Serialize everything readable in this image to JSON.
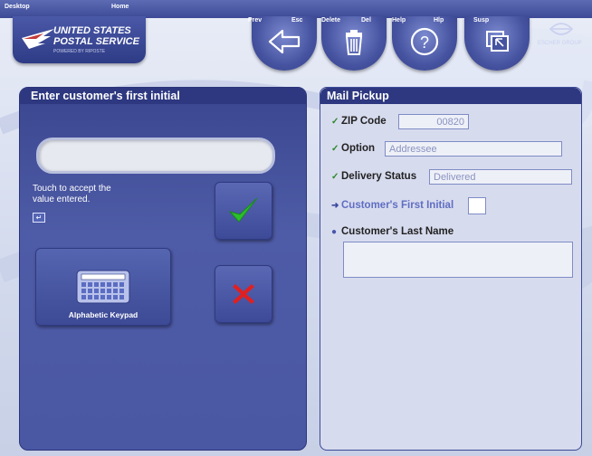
{
  "topbar": {
    "desktop": "Desktop",
    "home": "Home",
    "prev": "Prev",
    "esc": "Esc",
    "delete": "Delete",
    "del": "Del",
    "help": "Help",
    "hlp": "Hlp",
    "susp": "Susp"
  },
  "logo": {
    "line1": "UNITED STATES",
    "line2": "POSTAL SERVICE",
    "tagline": "POWERED BY RIPOSTE"
  },
  "brand_right": "ESCHER GROUP",
  "left_panel": {
    "title": "Enter customer's first initial",
    "entry_value": "",
    "hint_line1": "Touch to accept the",
    "hint_line2": "value entered.",
    "enter_glyph": "↵",
    "keypad_label": "Alphabetic Keypad"
  },
  "right_panel": {
    "title": "Mail Pickup",
    "fields": [
      {
        "label": "ZIP Code",
        "value": "00820",
        "status": "done"
      },
      {
        "label": "Option",
        "value": "Addressee",
        "status": "done"
      },
      {
        "label": "Delivery Status",
        "value": "Delivered",
        "status": "done"
      },
      {
        "label": "Customer's First Initial",
        "value": "",
        "status": "current"
      },
      {
        "label": "Customer's Last Name",
        "value": "",
        "status": "pending"
      }
    ]
  },
  "colors": {
    "accent": "#2d3880",
    "panel_left": "#4a57a3",
    "panel_right": "#d7dbee",
    "check_green": "#2bbf2b",
    "cancel_red": "#e02020"
  },
  "icons": [
    "back-arrow-icon",
    "trash-icon",
    "help-icon",
    "suspend-window-icon",
    "check-icon",
    "cancel-x-icon",
    "keypad-icon",
    "eagle-logo-icon"
  ]
}
